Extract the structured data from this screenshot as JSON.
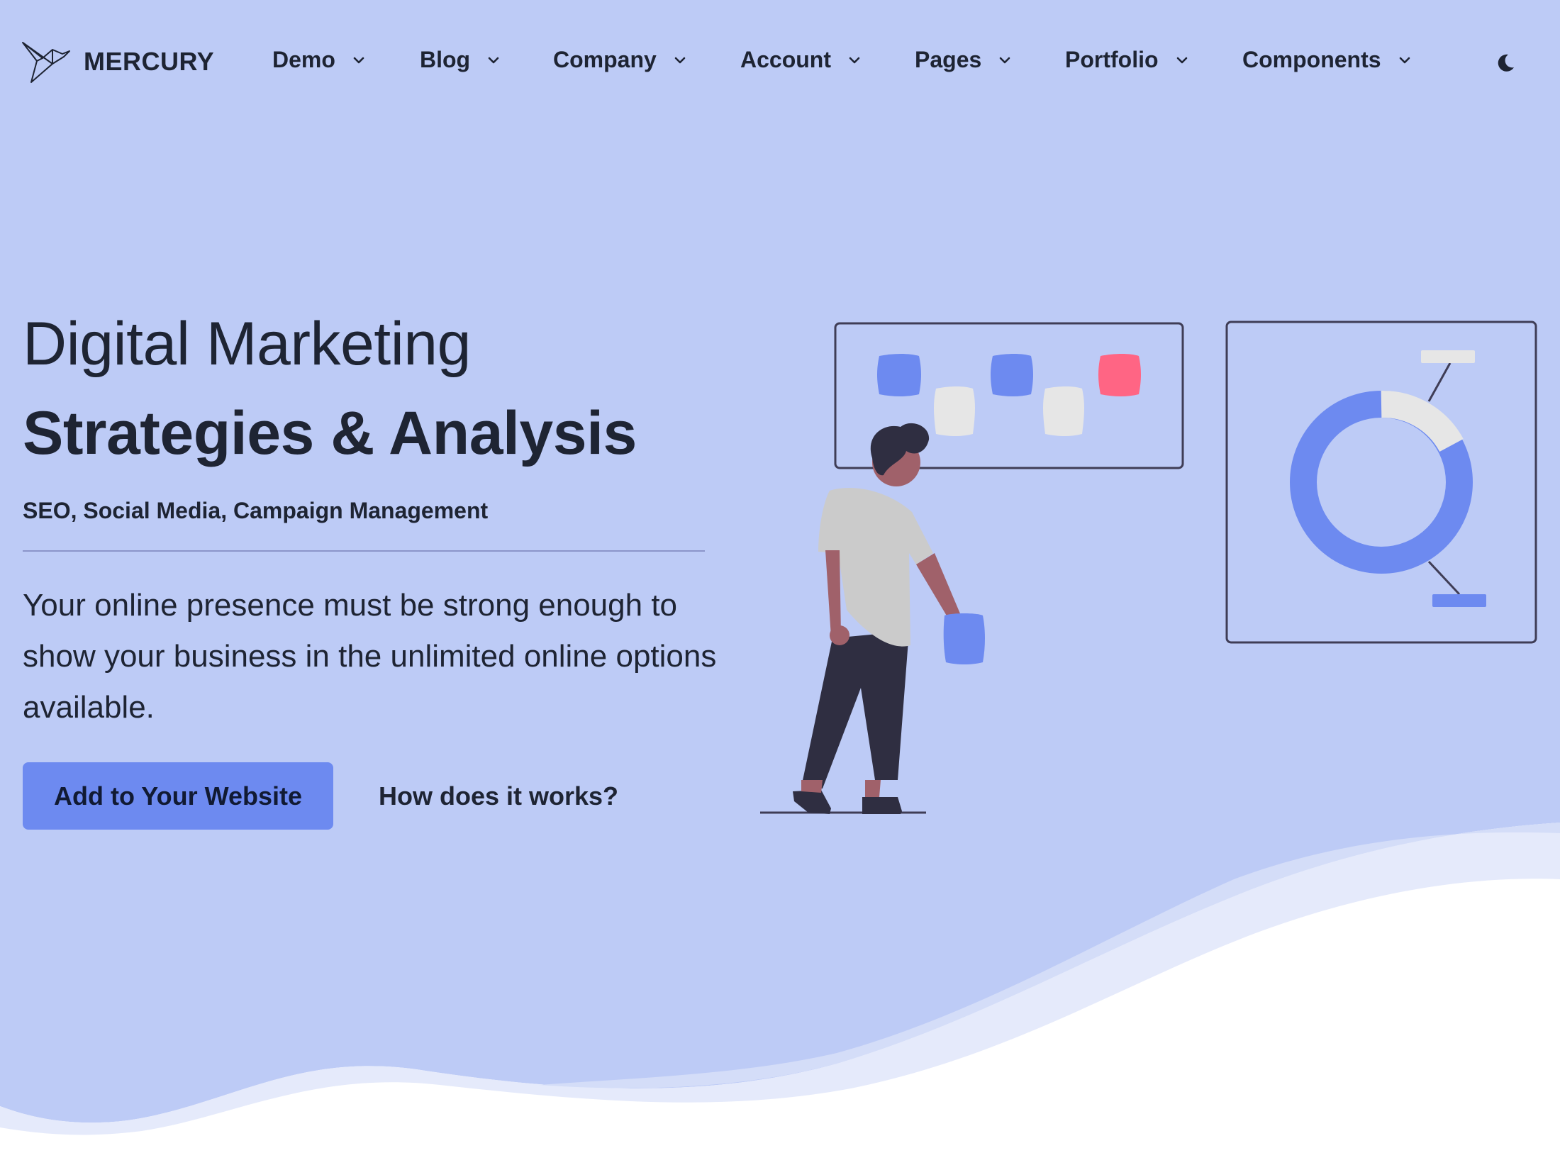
{
  "colors": {
    "hero_background": "#bdcbf6",
    "accent": "#6d8af0",
    "wave_light": "#e5eafb",
    "highlight_pink": "#ff6584",
    "text_dark": "#1e2433"
  },
  "navbar": {
    "brand_name": "MERCURY",
    "logo_icon": "origami-bird-icon",
    "menu": [
      {
        "label": "Demo"
      },
      {
        "label": "Blog"
      },
      {
        "label": "Company"
      },
      {
        "label": "Account"
      },
      {
        "label": "Pages"
      },
      {
        "label": "Portfolio"
      },
      {
        "label": "Components"
      }
    ],
    "theme_toggle_icon": "moon-icon"
  },
  "hero": {
    "title_line1": "Digital Marketing",
    "title_line2": "Strategies & Analysis",
    "subtitle": "SEO, Social Media, Campaign Management",
    "lead": "Your online presence must be strong enough to show your business in the unlimited online options available.",
    "primary_button": "Add to Your Website",
    "secondary_link": "How does it works?",
    "illustration": "person-analyzing-charts-illustration"
  }
}
